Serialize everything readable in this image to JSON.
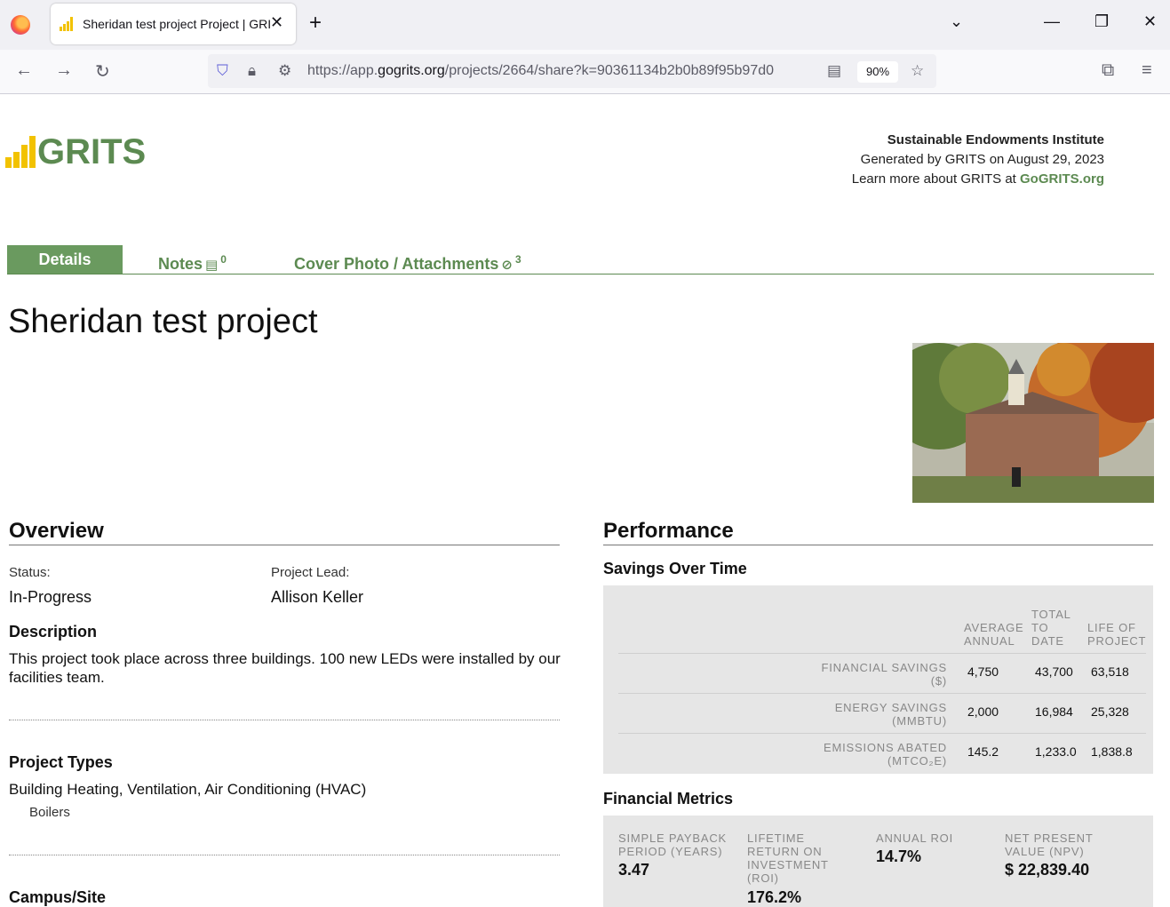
{
  "browser": {
    "tab_title": "Sheridan test project Project | GRITS",
    "url_prefix": "https://app.",
    "url_domain": "gogrits.org",
    "url_path": "/projects/2664/share?k=90361134b2b0b89f95b97d0",
    "zoom": "90%"
  },
  "header": {
    "logo_text": "GRITS",
    "org_name": "Sustainable Endowments Institute",
    "generated": "Generated by GRITS on August 29, 2023",
    "learn_more": "Learn more about GRITS at",
    "learn_more_link": "GoGRITS.org"
  },
  "tabs": [
    {
      "label": "Details",
      "count": ""
    },
    {
      "label": "Notes",
      "count": "0"
    },
    {
      "label": "Cover Photo / Attachments",
      "count": "3"
    }
  ],
  "project": {
    "title": "Sheridan test project"
  },
  "overview": {
    "heading": "Overview",
    "status_label": "Status:",
    "status": "In-Progress",
    "lead_label": "Project Lead:",
    "lead": "Allison Keller",
    "description_heading": "Description",
    "description": "This project took place across three buildings. 100 new LEDs were installed by our facilities team.",
    "types_heading": "Project Types",
    "type": "Building Heating, Ventilation, Air Conditioning (HVAC)",
    "subtype": "Boilers",
    "campus_heading": "Campus/Site"
  },
  "performance": {
    "heading": "Performance",
    "savings_heading": "Savings Over Time",
    "columns": [
      "AVERAGE ANNUAL",
      "TOTAL TO DATE",
      "LIFE OF PROJECT"
    ],
    "rows": [
      {
        "label1": "FINANCIAL SAVINGS",
        "label2": "($)",
        "values": [
          "4,750",
          "43,700",
          "63,518"
        ]
      },
      {
        "label1": "ENERGY SAVINGS",
        "label2": "(MMBTU)",
        "values": [
          "2,000",
          "16,984",
          "25,328"
        ]
      },
      {
        "label1": "EMISSIONS ABATED",
        "label2": "(MTCO₂E)",
        "values": [
          "145.2",
          "1,233.0",
          "1,838.8"
        ]
      }
    ],
    "financial_heading": "Financial Metrics",
    "metrics": [
      {
        "label": "SIMPLE PAYBACK PERIOD (YEARS)",
        "value": "3.47"
      },
      {
        "label": "LIFETIME RETURN ON INVESTMENT (ROI)",
        "value": "176.2%"
      },
      {
        "label": "ANNUAL ROI",
        "value": "14.7%"
      },
      {
        "label": "NET PRESENT VALUE (NPV)",
        "value": "$ 22,839.40"
      }
    ]
  }
}
